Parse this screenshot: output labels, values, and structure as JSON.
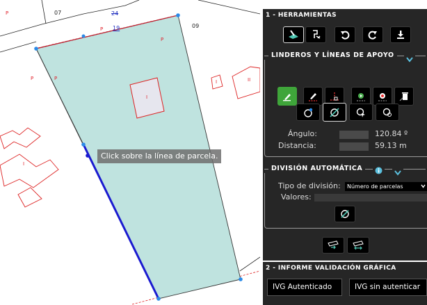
{
  "map": {
    "parcel_labels": [
      "07",
      "09"
    ],
    "street_numbers": [
      "24",
      "19"
    ],
    "building_marks": [
      "P",
      "P",
      "P",
      "P",
      "P",
      "I",
      "I",
      "II",
      "I"
    ],
    "tooltip": "Click sobre la línea de parcela."
  },
  "panel": {
    "section1_title": "1 - HERRAMIENTAS",
    "toolbar_icons": [
      "draw-parcel-icon",
      "edit-parcel-icon",
      "undo-icon",
      "redo-icon",
      "download-icon"
    ],
    "linderos": {
      "title": "LINDEROS Y LÍNEAS DE APOYO",
      "tools": [
        "pencil-icon",
        "dashed-pencil-icon",
        "perpendicular-icon",
        "play-point-icon",
        "record-point-icon",
        "delete-icon"
      ],
      "snap_tools": [
        "snap-vertex-icon",
        "snap-edge-icon",
        "select-icon",
        "rotate-select-icon"
      ],
      "angle_label": "Ángulo:",
      "angle_value": "120.84 º",
      "distance_label": "Distancia:",
      "distance_value": "59.13 m"
    },
    "division": {
      "title": "DIVISIÓN AUTOMÁTICA",
      "type_label": "Tipo de división:",
      "type_value": "Número de parcelas",
      "values_label": "Valores:",
      "values_value": ""
    },
    "section2_title": "2 - INFORME VALIDACIÓN GRÁFICA",
    "ivg_authenticated": "IVG Autenticado",
    "ivg_unauthenticated": "IVG sin autenticar"
  }
}
